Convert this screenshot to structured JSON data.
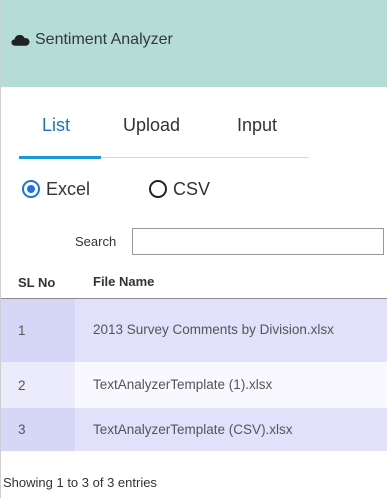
{
  "header": {
    "icon": "cloud-icon",
    "title": "Sentiment Analyzer",
    "background": "#b6dcd7"
  },
  "tabs": [
    {
      "label": "List",
      "active": true
    },
    {
      "label": "Upload",
      "active": false
    },
    {
      "label": "Input",
      "active": false
    }
  ],
  "file_type": {
    "options": [
      {
        "label": "Excel",
        "checked": true
      },
      {
        "label": "CSV",
        "checked": false
      }
    ]
  },
  "search": {
    "label": "Search",
    "value": ""
  },
  "table": {
    "columns": [
      "SL No",
      "File Name"
    ],
    "rows": [
      {
        "sl": "1",
        "name": "2013 Survey Comments by Division.xlsx"
      },
      {
        "sl": "2",
        "name": "TextAnalyzerTemplate (1).xlsx"
      },
      {
        "sl": "3",
        "name": "TextAnalyzerTemplate (CSV).xlsx"
      }
    ]
  },
  "footer": {
    "info": "Showing 1 to 3 of 3 entries"
  },
  "colors": {
    "accent": "#1a73e8",
    "tab_indicator": "#1a9ad8",
    "row_odd": "#e1e1fb",
    "row_even": "#f8f8fe"
  }
}
